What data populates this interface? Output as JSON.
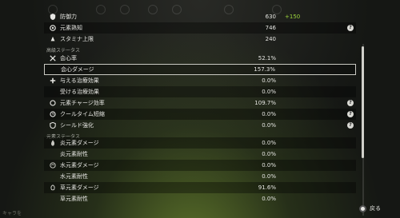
{
  "rows_top": [
    {
      "label": "防御力",
      "value": "630",
      "bonus": "+150",
      "help": false
    },
    {
      "label": "元素熟知",
      "value": "746",
      "bonus": "",
      "help": true
    },
    {
      "label": "スタミナ上限",
      "value": "240",
      "bonus": "",
      "help": false
    }
  ],
  "section_advanced": "高級ステータス",
  "rows_adv": [
    {
      "label": "会心率",
      "value": "52.1%",
      "help": false
    },
    {
      "label": "会心ダメージ",
      "value": "157.3%",
      "help": false
    },
    {
      "label": "与える治療効果",
      "value": "0.0%",
      "help": false
    },
    {
      "label": "受ける治療効果",
      "value": "0.0%",
      "help": false
    },
    {
      "label": "元素チャージ効率",
      "value": "109.7%",
      "help": true
    },
    {
      "label": "クールタイム短縮",
      "value": "0.0%",
      "help": true
    },
    {
      "label": "シールド強化",
      "value": "0.0%",
      "help": true
    }
  ],
  "section_element": "元素ステータス",
  "rows_elem": [
    {
      "label": "炎元素ダメージ",
      "value": "0.0%"
    },
    {
      "label": "炎元素耐性",
      "value": "0.0%"
    },
    {
      "label": "水元素ダメージ",
      "value": "0.0%"
    },
    {
      "label": "水元素耐性",
      "value": "0.0%"
    },
    {
      "label": "草元素ダメージ",
      "value": "91.6%"
    },
    {
      "label": "草元素耐性",
      "value": "0.0%"
    }
  ],
  "footer": {
    "left_hint": "キャラを",
    "back_label": "戻る"
  },
  "help_glyph": "?"
}
